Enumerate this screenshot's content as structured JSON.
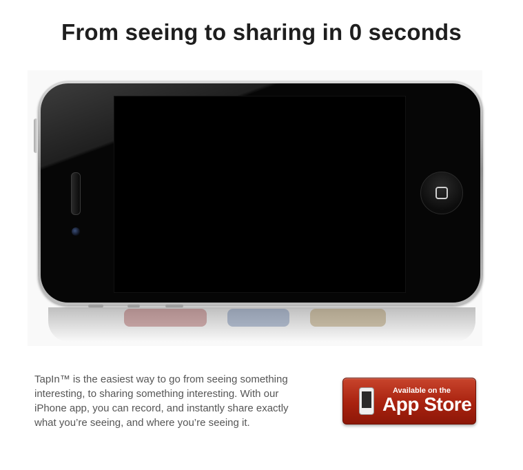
{
  "headline": "From seeing to sharing in 0 seconds",
  "description": "TapIn™ is the easiest way to go from seeing something interesting, to sharing something interesting. With our iPhone app, you can record, and instantly share exactly what you’re seeing, and where you’re seeing it.",
  "app_store_button": {
    "small_label": "Available on the",
    "big_label": "App Store",
    "icon": "iphone-icon"
  },
  "hero_image": {
    "icon": "iphone-device"
  },
  "colors": {
    "headline": "#1e1e1e",
    "body_text": "#555555",
    "store_button": "#a8220f"
  }
}
